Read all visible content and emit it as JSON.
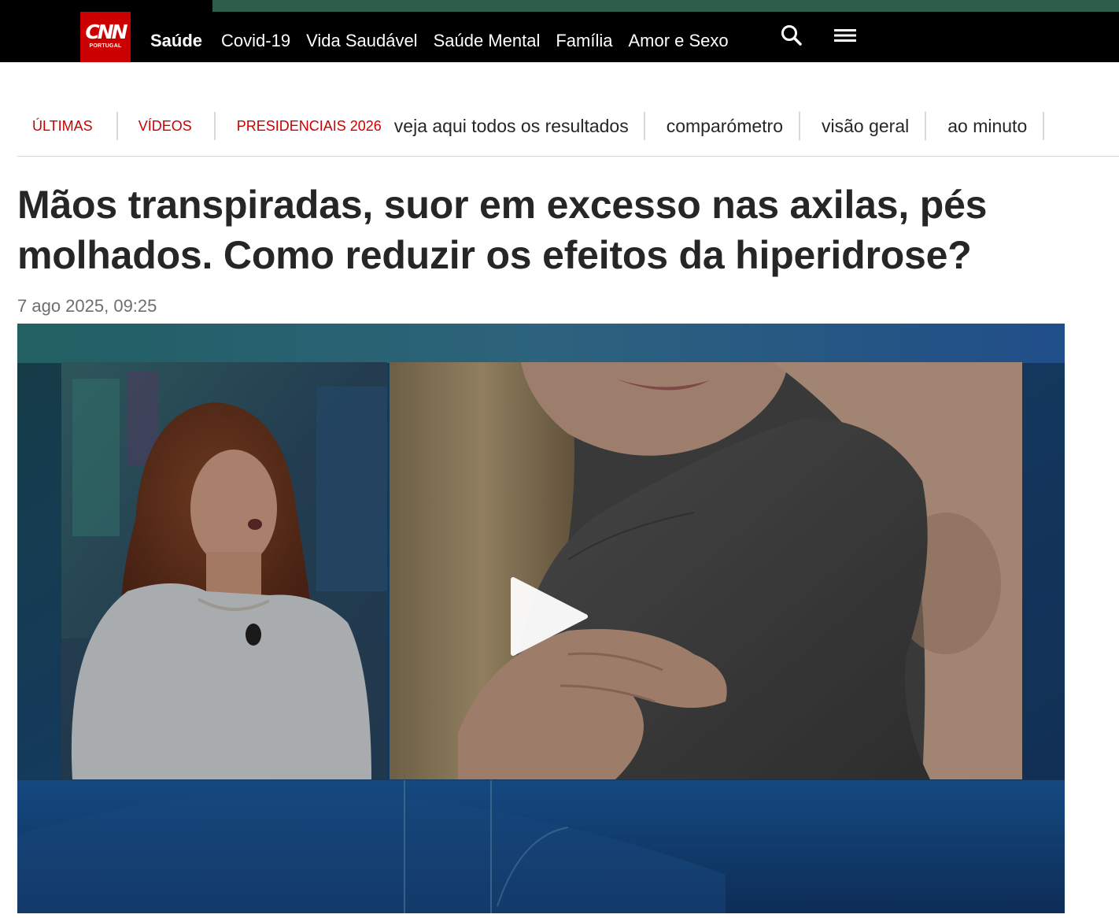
{
  "header": {
    "logo": {
      "main": "CNN",
      "sub": "PORTUGAL"
    },
    "nav": [
      {
        "label": "Saúde",
        "active": true
      },
      {
        "label": "Covid-19"
      },
      {
        "label": "Vida Saudável"
      },
      {
        "label": "Saúde Mental"
      },
      {
        "label": "Família"
      },
      {
        "label": "Amor e Sexo"
      }
    ],
    "icons": {
      "search": "search-icon",
      "menu": "hamburger-menu-icon"
    },
    "colors": {
      "bar": "#000000",
      "accent_strip": "#2d5e4b",
      "logo": "#cc0000"
    }
  },
  "subnav": {
    "items": [
      "ÚLTIMAS",
      "VÍDEOS",
      "PRESIDENCIAIS 2026"
    ],
    "links": [
      "veja aqui todos os resultados",
      "comparómetro",
      "visão geral",
      "ao minuto"
    ],
    "accent_color": "#cc0000"
  },
  "article": {
    "title": "Mãos transpiradas, suor em excesso nas axilas, pés molhados. Como reduzir os efeitos da hiperidrose?",
    "date": "7 ago 2025, 09:25"
  },
  "video": {
    "play_icon": "play-icon"
  }
}
